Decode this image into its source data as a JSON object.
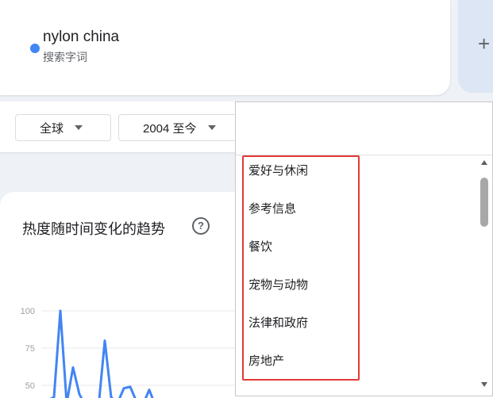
{
  "search_term": {
    "title": "nylon china",
    "subtitle": "搜索字词",
    "color": "#4285f4"
  },
  "add_button": {
    "icon": "plus-icon",
    "label": "+"
  },
  "filters": {
    "geo": {
      "label": "全球",
      "icon": "caret-down-icon"
    },
    "time": {
      "label": "2004 至今",
      "icon": "caret-down-icon"
    }
  },
  "category_dropdown": {
    "items": [
      "爱好与休闲",
      "参考信息",
      "餐饮",
      "宠物与动物",
      "法律和政府",
      "房地产"
    ],
    "highlight_color": "#e53935"
  },
  "chart_section": {
    "title": "热度随时间变化的趋势",
    "help_icon": "help-icon",
    "help_glyph": "?"
  },
  "chart_data": {
    "type": "line",
    "y_ticks": [
      "100",
      "75",
      "50"
    ],
    "ylim": [
      50,
      100
    ],
    "grid": true,
    "series": [
      {
        "color": "#4285f4",
        "points": [
          [
            0,
            40
          ],
          [
            1,
            42
          ],
          [
            2,
            100
          ],
          [
            3,
            38
          ],
          [
            4,
            62
          ],
          [
            5,
            44
          ],
          [
            6,
            36
          ],
          [
            7,
            40
          ],
          [
            8,
            35
          ],
          [
            9,
            80
          ],
          [
            10,
            42
          ],
          [
            11,
            38
          ],
          [
            12,
            48
          ],
          [
            13,
            49
          ],
          [
            14,
            39
          ],
          [
            15,
            37
          ],
          [
            16,
            47
          ],
          [
            17,
            36
          ]
        ]
      }
    ]
  }
}
